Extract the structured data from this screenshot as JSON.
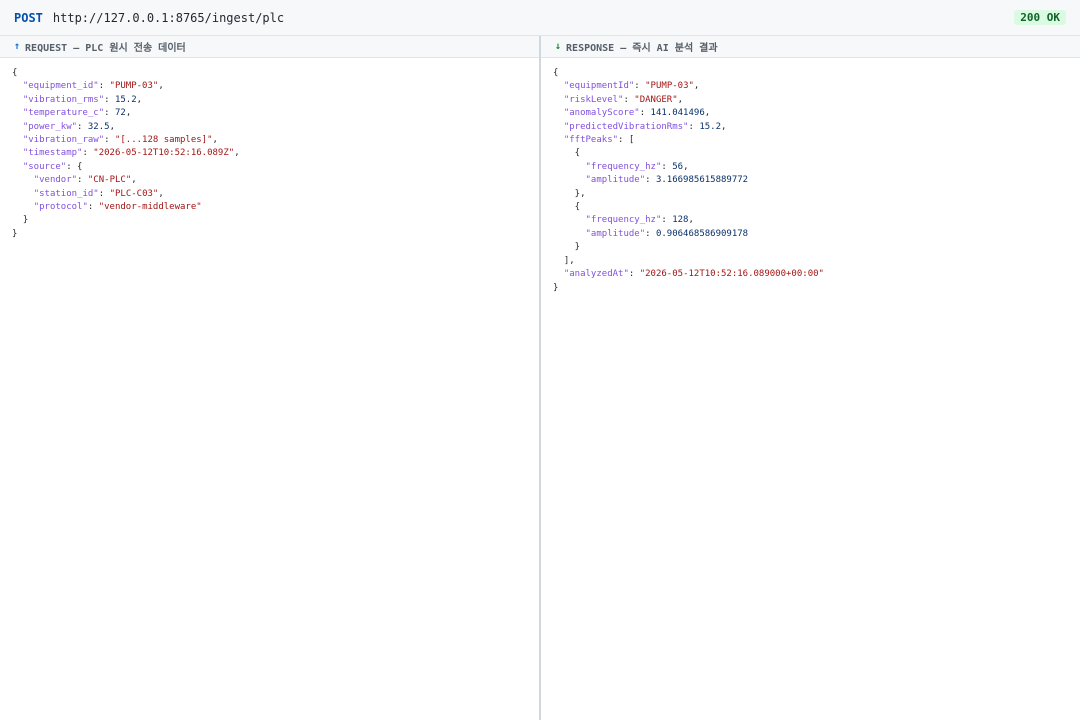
{
  "request_bar": {
    "method": "POST",
    "url": "http://127.0.0.1:8765/ingest/plc",
    "status": "200 OK"
  },
  "request_pane": {
    "arrow": "↑",
    "title": "REQUEST — PLC 원시 전송 데이터",
    "body": {
      "equipment_id": "\"PUMP-03\"",
      "vibration_rms": "15.2",
      "temperature_c": "72",
      "power_kw": "32.5",
      "vibration_raw": "\"[...128 samples]\"",
      "timestamp": "\"2026-05-12T10:52:16.089Z\"",
      "source_vendor": "\"CN-PLC\"",
      "source_station_id": "\"PLC-C03\"",
      "source_protocol": "\"vendor-middleware\""
    }
  },
  "response_pane": {
    "arrow": "↓",
    "title": "RESPONSE — 즉시 AI 분석 결과",
    "body": {
      "equipmentId": "\"PUMP-03\"",
      "riskLevel": "\"DANGER\"",
      "anomalyScore": "141.041496",
      "predictedVibrationRms": "15.2",
      "fftPeaks": [
        {
          "frequency_hz": "56",
          "amplitude": "3.166985615889772"
        },
        {
          "frequency_hz": "128",
          "amplitude": "0.906468586909178"
        }
      ],
      "analyzedAt": "\"2026-05-12T10:52:16.089000+00:00\""
    }
  },
  "colors": {
    "method": "#0550ae",
    "status_bg": "#dafbe1",
    "status_fg": "#116329",
    "json_key": "#8250df",
    "json_string": "#a31515",
    "json_number": "#0a3069"
  }
}
